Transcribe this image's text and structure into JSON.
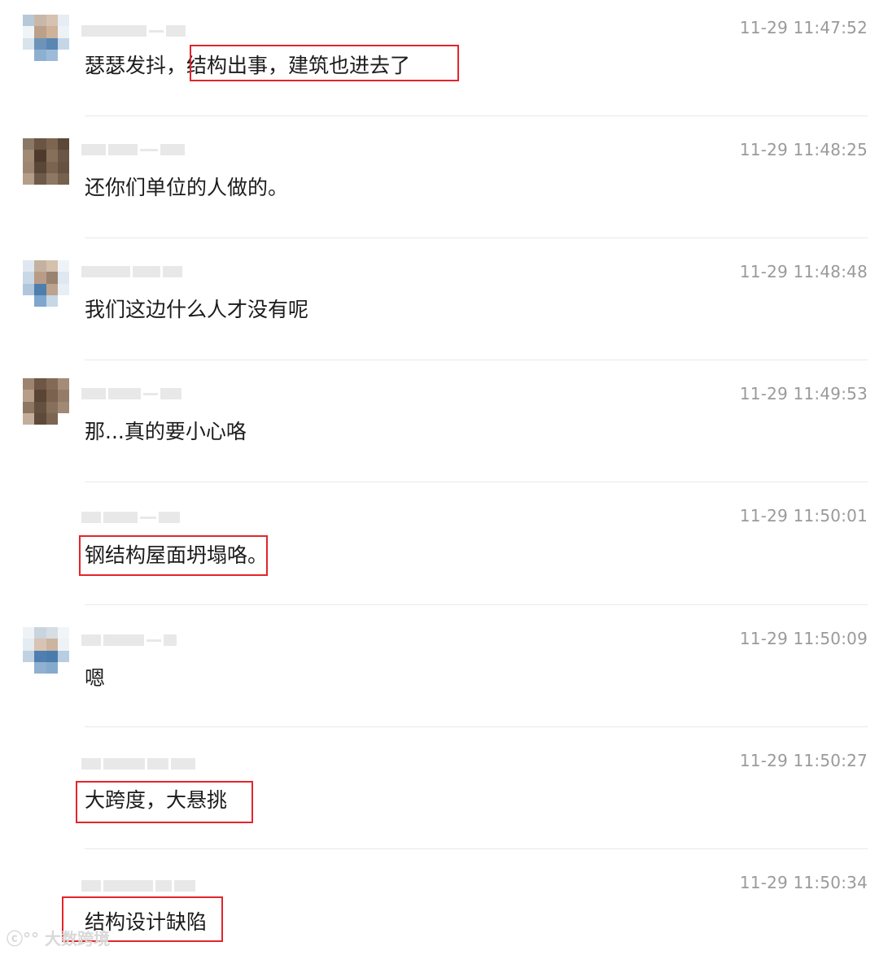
{
  "messages": [
    {
      "time": "11-29 11:47:52",
      "pre": "瑟瑟发抖，",
      "hl": "结构出事，建筑也进去了",
      "post": ""
    },
    {
      "time": "11-29 11:48:25",
      "pre": "还你们单位的人做的。",
      "hl": "",
      "post": ""
    },
    {
      "time": "11-29 11:48:48",
      "pre": "我们这边什么人才没有呢",
      "hl": "",
      "post": ""
    },
    {
      "time": "11-29 11:49:53",
      "pre": "那...真的要小心咯",
      "hl": "",
      "post": ""
    },
    {
      "time": "11-29 11:50:01",
      "pre": "",
      "hl": "钢结构屋面坍塌咯。",
      "post": ""
    },
    {
      "time": "11-29 11:50:09",
      "pre": "嗯",
      "hl": "",
      "post": ""
    },
    {
      "time": "11-29 11:50:27",
      "pre": "",
      "hl": "大跨度，大悬挑",
      "post": ""
    },
    {
      "time": "11-29 11:50:34",
      "pre": "",
      "hl": "结构设计缺陷",
      "post": ""
    }
  ],
  "watermark": "大数跨境",
  "colors": {
    "highlight": "#e4242b",
    "time": "#9a9a9a",
    "text": "#1c1c1c",
    "divider": "#e9e9e9"
  }
}
